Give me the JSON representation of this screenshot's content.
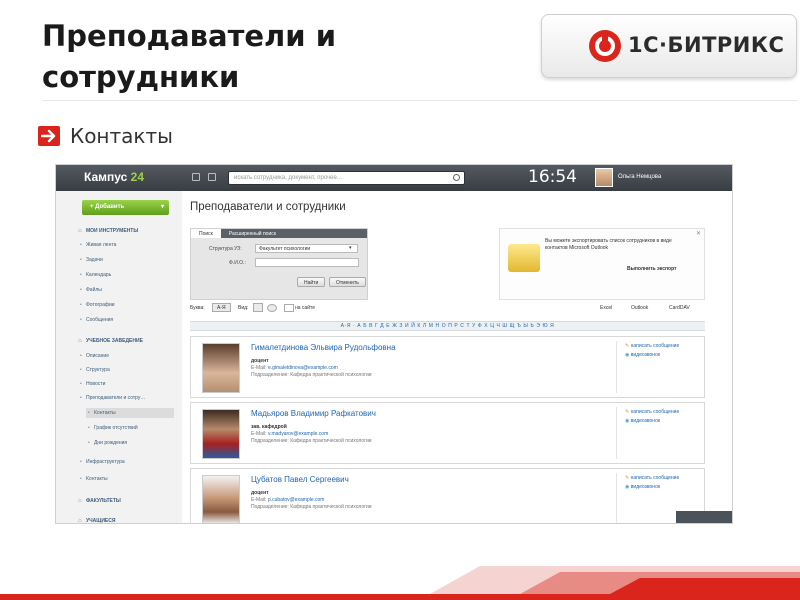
{
  "slide": {
    "title": "Преподаватели и сотрудники",
    "bullet": "Контакты",
    "logo_text": "1С·БИТРИКС",
    "accent": "#d9251c"
  },
  "app": {
    "brand_name": "Кампус",
    "brand_num": "24",
    "search_placeholder": "искать сотрудника, документ, прочее…",
    "clock": "16:54",
    "user_name": "Ольга Немцова",
    "add_button": "+ Добавить",
    "sidebar": {
      "head1": "МОИ ИНСТРУМЕНТЫ",
      "tools": [
        "Живая лента",
        "Задачи",
        "Календарь",
        "Файлы",
        "Фотографии",
        "Сообщения"
      ],
      "head2": "УЧЕБНОЕ ЗАВЕДЕНИЕ",
      "school": [
        "Описание",
        "Структура",
        "Новости",
        "Преподаватели и сотру…"
      ],
      "sub": [
        "Контакты",
        "График отсутствий",
        "Дни рождения"
      ],
      "more": [
        "Инфраструктура",
        "Контакты"
      ],
      "head3": "ФАКУЛЬТЕТЫ",
      "head4": "УЧАЩИЕСЯ"
    },
    "page_title": "Преподаватели и сотрудники",
    "tabs": [
      "Поиск",
      "Расширенный поиск"
    ],
    "form": {
      "struct_label": "Структура УЗ:",
      "struct_value": "Факультет психологии",
      "fio_label": "Ф.И.О.:",
      "find": "Найти",
      "cancel": "Отменить"
    },
    "export": {
      "text": "Вы можете экспортировать список сотрудников в виде контактов Microsoft Outlook",
      "link": "Выполнить экспорт",
      "close": "✕"
    },
    "toolbar": {
      "letter_label": "Буква:",
      "letter_btn": "А-Я",
      "view_label": "Вид:",
      "online": "на сайте",
      "excel": "Excel",
      "outlook": "Outlook",
      "carddav": "CardDAV"
    },
    "alphabet": "А-Я · А Б В Г Д Е Ж З И Й К Л М Н О П Р С Т У Ф Х Ц Ч Ш Щ Ъ Ы Ь Э Ю Я",
    "people": [
      {
        "name": "Гималетдинова Эльвира Рудольфовна",
        "position": "доцент",
        "email_label": "E-Mail:",
        "email": "e.gimaletdinova@example.com",
        "dept": "Подразделение: Кафедра практической психологии",
        "write": "написать сообщение",
        "video": "видеозвонок"
      },
      {
        "name": "Мадьяров Владимир Рафкатович",
        "position": "зав. кафедрой",
        "email_label": "E-Mail:",
        "email": "v.madyarov@example.com",
        "dept": "Подразделение: Кафедра практической психологии",
        "write": "написать сообщение",
        "video": "видеозвонок"
      },
      {
        "name": "Цубатов Павел Сергеевич",
        "position": "доцент",
        "email_label": "E-Mail:",
        "email": "p.cubatov@example.com",
        "dept": "Подразделение: Кафедра практической психологии",
        "write": "написать сообщение",
        "video": "видеозвонок"
      }
    ]
  }
}
